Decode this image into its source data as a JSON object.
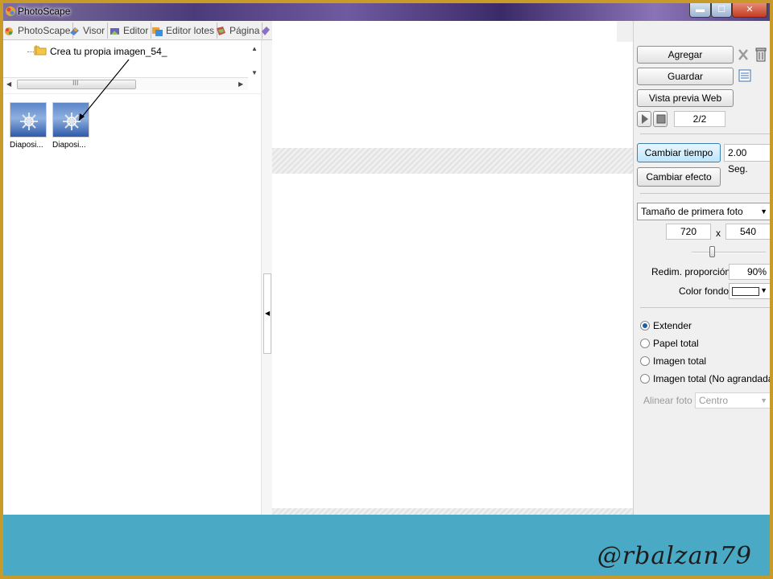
{
  "window": {
    "title": "PhotoScape"
  },
  "tabs": [
    {
      "label": "PhotoScape",
      "icon": "photoscape-icon"
    },
    {
      "label": "Visor",
      "icon": "viewer-icon"
    },
    {
      "label": "Editor",
      "icon": "editor-icon"
    },
    {
      "label": "Editor lotes",
      "icon": "batch-editor-icon"
    },
    {
      "label": "Página",
      "icon": "page-icon"
    }
  ],
  "tree": {
    "folder_label": "Crea tu propia imagen_54_"
  },
  "thumbnails": [
    {
      "label": "Diaposi..."
    },
    {
      "label": "Diaposi..."
    }
  ],
  "panel": {
    "add_label": "Agregar",
    "save_label": "Guardar",
    "web_preview_label": "Vista previa Web",
    "counter": "2/2",
    "change_time_label": "Cambiar tiempo",
    "time_value": "2.00 Seg.",
    "change_effect_label": "Cambiar efecto",
    "size_option": "Tamaño de primera foto",
    "width": "720",
    "times": "x",
    "height": "540",
    "resize_label": "Redim. proporción",
    "resize_value": "90%",
    "bg_color_label": "Color fondo",
    "bg_color": "#ffffff",
    "fit_options": [
      {
        "label": "Extender",
        "selected": true
      },
      {
        "label": "Papel total",
        "selected": false
      },
      {
        "label": "Imagen total",
        "selected": false
      },
      {
        "label": "Imagen total (No agrandada)",
        "selected": false
      }
    ],
    "align_label": "Alinear foto",
    "align_value": "Centro"
  },
  "watermark": "@rbalzan79",
  "colors": {
    "footer": "#4aa9c4",
    "accent": "#1f5fa8"
  }
}
